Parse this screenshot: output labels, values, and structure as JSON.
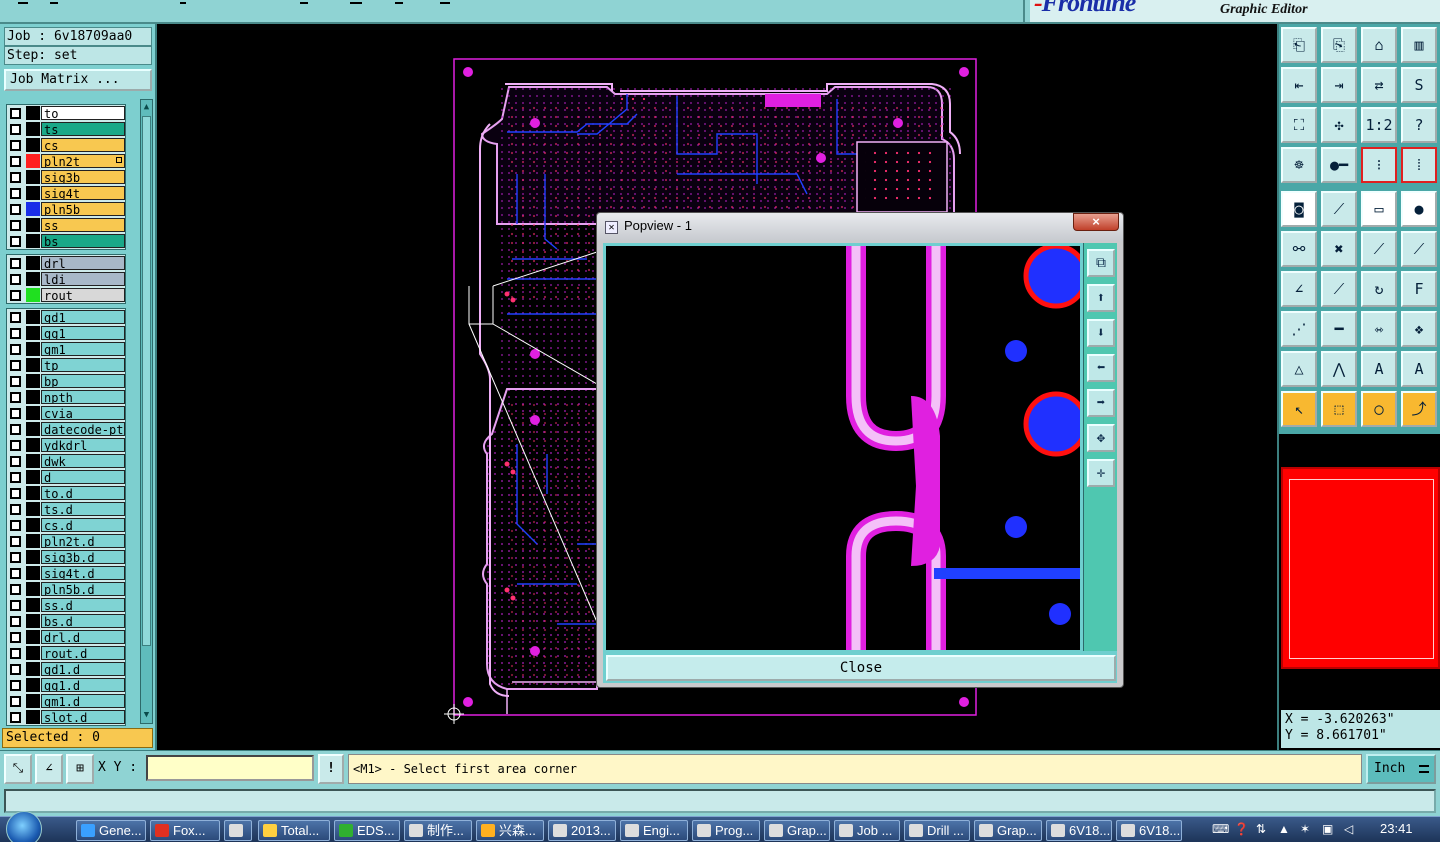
{
  "header": {
    "brand_mark": "Frontline",
    "app_subtitle": "Graphic Editor"
  },
  "left": {
    "job_line": "Job : 6v18709aa0",
    "step_line": "Step: set",
    "job_matrix_label": "Job Matrix ...",
    "selected_label": "Selected : 0",
    "groups": [
      [
        {
          "name": "to",
          "bg": "#ffffff",
          "swatch": "#000000"
        },
        {
          "name": "ts",
          "bg": "#1aa888",
          "swatch": "#000000"
        },
        {
          "name": "cs",
          "bg": "#f8c850",
          "swatch": "#000000"
        },
        {
          "name": "pln2t",
          "bg": "#f8c850",
          "swatch": "#ff2020",
          "mark": true
        },
        {
          "name": "sig3b",
          "bg": "#f8c850",
          "swatch": "#000000"
        },
        {
          "name": "sig4t",
          "bg": "#f8c850",
          "swatch": "#000000"
        },
        {
          "name": "pln5b",
          "bg": "#f8c850",
          "swatch": "#1a2ee8"
        },
        {
          "name": "ss",
          "bg": "#f8c850",
          "swatch": "#000000"
        },
        {
          "name": "bs",
          "bg": "#1aa888",
          "swatch": "#000000"
        }
      ],
      [
        {
          "name": "drl",
          "bg": "#a8b8c8",
          "swatch": "#000000"
        },
        {
          "name": "ldi",
          "bg": "#a8b8c8",
          "swatch": "#000000"
        },
        {
          "name": "rout",
          "bg": "#d8d8d8",
          "swatch": "#20e020"
        }
      ],
      [
        {
          "name": "gd1",
          "bg": "#7fd3d3",
          "swatch": "#000000"
        },
        {
          "name": "gg1",
          "bg": "#7fd3d3",
          "swatch": "#000000"
        },
        {
          "name": "gm1",
          "bg": "#7fd3d3",
          "swatch": "#000000"
        },
        {
          "name": "tp",
          "bg": "#7fd3d3",
          "swatch": "#000000"
        },
        {
          "name": "bp",
          "bg": "#7fd3d3",
          "swatch": "#000000"
        },
        {
          "name": "npth",
          "bg": "#7fd3d3",
          "swatch": "#000000"
        },
        {
          "name": "cvia",
          "bg": "#7fd3d3",
          "swatch": "#000000"
        },
        {
          "name": "datecode-pte",
          "bg": "#7fd3d3",
          "swatch": "#000000"
        },
        {
          "name": "ydkdrl",
          "bg": "#7fd3d3",
          "swatch": "#000000"
        },
        {
          "name": "dwk",
          "bg": "#7fd3d3",
          "swatch": "#000000"
        },
        {
          "name": "d",
          "bg": "#7fd3d3",
          "swatch": "#000000"
        },
        {
          "name": "to.d",
          "bg": "#7fd3d3",
          "swatch": "#000000"
        },
        {
          "name": "ts.d",
          "bg": "#7fd3d3",
          "swatch": "#000000"
        },
        {
          "name": "cs.d",
          "bg": "#7fd3d3",
          "swatch": "#000000"
        },
        {
          "name": "pln2t.d",
          "bg": "#7fd3d3",
          "swatch": "#000000"
        },
        {
          "name": "sig3b.d",
          "bg": "#7fd3d3",
          "swatch": "#000000"
        },
        {
          "name": "sig4t.d",
          "bg": "#7fd3d3",
          "swatch": "#000000"
        },
        {
          "name": "pln5b.d",
          "bg": "#7fd3d3",
          "swatch": "#000000"
        },
        {
          "name": "ss.d",
          "bg": "#7fd3d3",
          "swatch": "#000000"
        },
        {
          "name": "bs.d",
          "bg": "#7fd3d3",
          "swatch": "#000000"
        },
        {
          "name": "drl.d",
          "bg": "#7fd3d3",
          "swatch": "#000000"
        },
        {
          "name": "rout.d",
          "bg": "#7fd3d3",
          "swatch": "#000000"
        },
        {
          "name": "gd1.d",
          "bg": "#7fd3d3",
          "swatch": "#000000"
        },
        {
          "name": "gg1.d",
          "bg": "#7fd3d3",
          "swatch": "#000000"
        },
        {
          "name": "gm1.d",
          "bg": "#7fd3d3",
          "swatch": "#000000"
        },
        {
          "name": "slot.d",
          "bg": "#7fd3d3",
          "swatch": "#000000"
        }
      ]
    ]
  },
  "popview": {
    "title": "Popview - 1",
    "close_x": "×",
    "close_label": "Close"
  },
  "right": {
    "ratio_label": "1:2",
    "help_label": "?",
    "coord_x": "X = -3.620263\"",
    "coord_y": "Y = 8.661701\""
  },
  "command": {
    "xy_label": "X Y :",
    "xy_value": "",
    "bang_label": "!",
    "prompt": "<M1> - Select first area corner",
    "unit": "Inch"
  },
  "taskbar": {
    "items": [
      {
        "label": "Gene...",
        "color": "#3aa0ff"
      },
      {
        "label": "Fox...",
        "color": "#e03020"
      },
      {
        "label": "",
        "color": "#dddddd"
      },
      {
        "label": "Total...",
        "color": "#ffd040"
      },
      {
        "label": "EDS...",
        "color": "#30b030"
      },
      {
        "label": "制作...",
        "color": "#dddddd"
      },
      {
        "label": "兴森...",
        "color": "#ffb020"
      },
      {
        "label": "2013...",
        "color": "#dddddd"
      },
      {
        "label": "Engi...",
        "color": "#dddddd"
      },
      {
        "label": "Prog...",
        "color": "#dddddd"
      },
      {
        "label": "Grap...",
        "color": "#dddddd"
      },
      {
        "label": "Job ...",
        "color": "#dddddd"
      },
      {
        "label": "Drill ...",
        "color": "#dddddd"
      },
      {
        "label": "Grap...",
        "color": "#dddddd"
      },
      {
        "label": "6V18...",
        "color": "#dddddd"
      },
      {
        "label": "6V18...",
        "color": "#dddddd"
      }
    ],
    "clock": "23:41"
  },
  "colors": {
    "board_magenta": "#e020e0",
    "trace_blue": "#2030ff",
    "pad_red": "#ff1010",
    "panel_cyan": "#8fd3d3"
  }
}
